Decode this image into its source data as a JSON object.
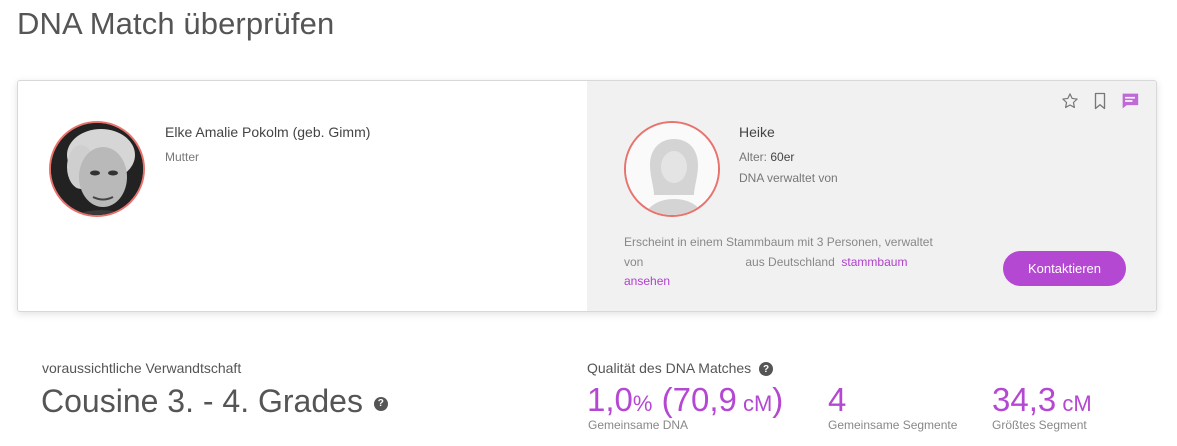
{
  "page": {
    "title": "DNA Match überprüfen"
  },
  "colors": {
    "accent": "#b548d2",
    "ring": "#e8726c",
    "panel_bg": "#f1f1f1"
  },
  "tester": {
    "name": "Elke Amalie Pokolm (geb. Gimm)",
    "relation": "Mutter",
    "photo": "portrait-photo"
  },
  "match": {
    "name": "Heike",
    "age_label": "Alter:",
    "age_value": "60er",
    "managed_by": "DNA verwaltet von",
    "desc_part1": "Erscheint in einem Stammbaum mit 3 Personen, verwaltet",
    "desc_von": "von",
    "desc_country": "aus Deutschland",
    "link_part1": "stammbaum",
    "link_part2": "ansehen",
    "contact_label": "Kontaktieren",
    "icons": [
      "star-icon",
      "bookmark-icon",
      "message-icon"
    ]
  },
  "relationship": {
    "label": "voraussichtliche Verwandtschaft",
    "value": "Cousine 3. - 4. Grades",
    "help": "?"
  },
  "quality": {
    "label": "Qualität des DNA Matches",
    "help": "?",
    "shared_dna": {
      "num": "1,0",
      "pct": "%",
      "paren_open": " (",
      "cm": "70,9",
      "unit": " cM",
      "paren_close": ")",
      "label": "Gemeinsame DNA"
    },
    "segments": {
      "value": "4",
      "label": "Gemeinsame Segmente"
    },
    "largest": {
      "value": "34,3",
      "unit": " cM",
      "label": "Größtes Segment"
    }
  }
}
